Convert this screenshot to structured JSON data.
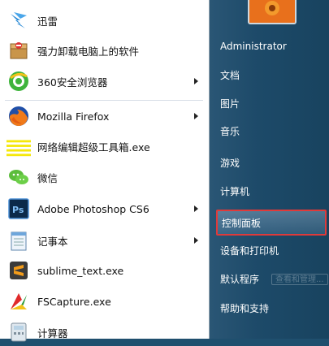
{
  "programs": [
    {
      "label": "迅雷",
      "icon": "thunder-bird-icon",
      "submenu": false
    },
    {
      "label": "强力卸载电脑上的软件",
      "icon": "uninstall-box-icon",
      "submenu": false
    },
    {
      "label": "360安全浏览器",
      "icon": "360-browser-icon",
      "submenu": true
    },
    {
      "label": "Mozilla Firefox",
      "icon": "firefox-icon",
      "submenu": true
    },
    {
      "label": "网络编辑超级工具箱.exe",
      "icon": "toolbox-icon",
      "submenu": false
    },
    {
      "label": "微信",
      "icon": "wechat-icon",
      "submenu": false
    },
    {
      "label": "Adobe Photoshop CS6",
      "icon": "photoshop-icon",
      "submenu": true
    },
    {
      "label": "记事本",
      "icon": "notepad-icon",
      "submenu": true
    },
    {
      "label": "sublime_text.exe",
      "icon": "sublime-icon",
      "submenu": false
    },
    {
      "label": "FSCapture.exe",
      "icon": "fscapture-icon",
      "submenu": false
    },
    {
      "label": "计算器",
      "icon": "calculator-icon",
      "submenu": false
    }
  ],
  "right": {
    "user": "Administrator",
    "items": [
      "文档",
      "图片",
      "音乐",
      "游戏",
      "计算机",
      "控制面板",
      "设备和打印机",
      "默认程序",
      "帮助和支持"
    ],
    "highlighted": "控制面板",
    "tooltip": "查看和管理..."
  },
  "colors": {
    "right_pane": "#1f4f6e",
    "highlight_border": "#e03a3a"
  }
}
